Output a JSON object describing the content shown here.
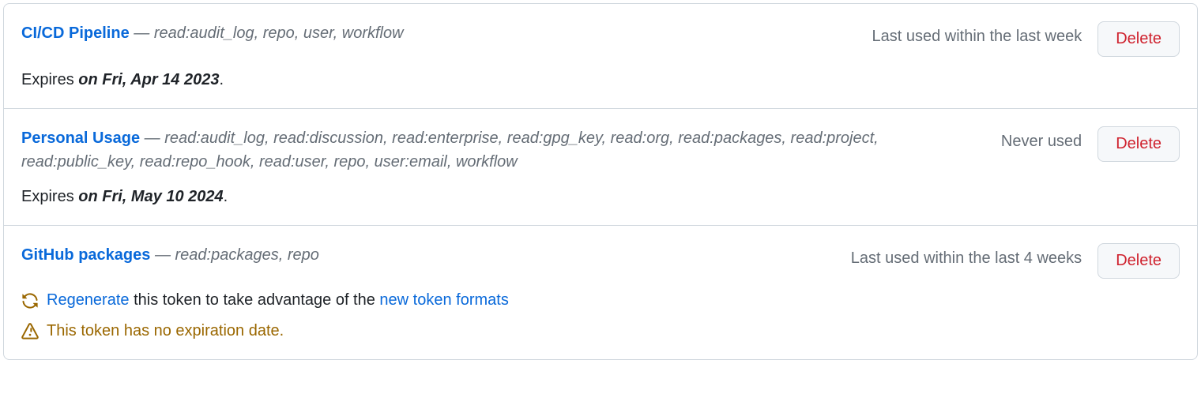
{
  "tokens": [
    {
      "name": "CI/CD Pipeline",
      "scopes": "read:audit_log, repo, user, workflow",
      "last_used": "Last used within the last week",
      "delete_label": "Delete",
      "expires_prefix": "Expires ",
      "expires_date": "on Fri, Apr 14 2023",
      "expires_suffix": "."
    },
    {
      "name": "Personal Usage",
      "scopes": "read:audit_log, read:discussion, read:enterprise, read:gpg_key, read:org, read:packages, read:project, read:public_key, read:repo_hook, read:user, repo, user:email, workflow",
      "last_used": "Never used",
      "delete_label": "Delete",
      "expires_prefix": "Expires ",
      "expires_date": "on Fri, May 10 2024",
      "expires_suffix": "."
    },
    {
      "name": "GitHub packages",
      "scopes": "read:packages, repo",
      "last_used": "Last used within the last 4 weeks",
      "delete_label": "Delete",
      "regenerate_link": "Regenerate",
      "regenerate_mid": " this token to take advantage of the ",
      "regenerate_link2": "new token formats",
      "warning_text": "This token has no expiration date."
    }
  ],
  "dash": " — "
}
